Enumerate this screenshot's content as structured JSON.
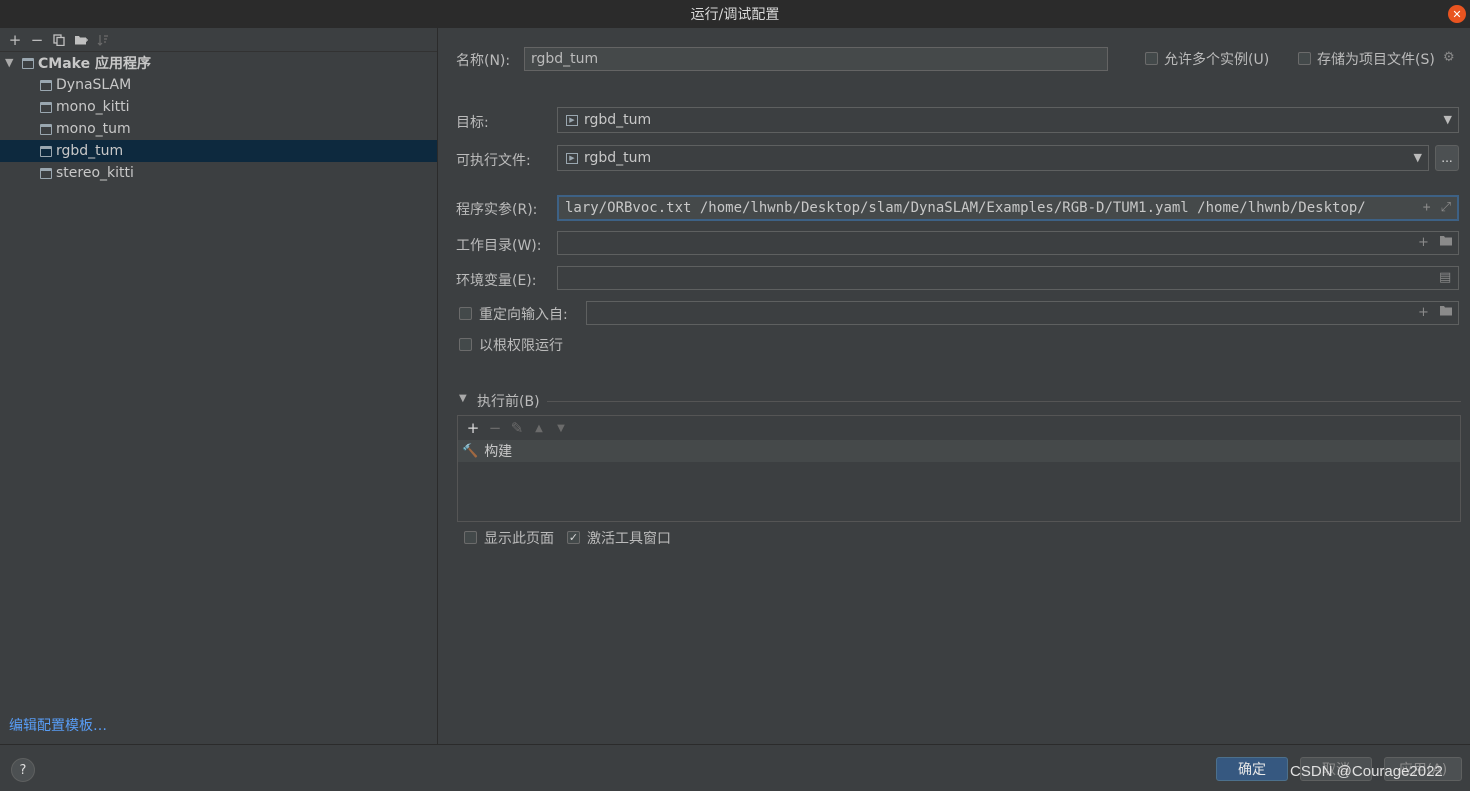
{
  "window": {
    "title": "运行/调试配置"
  },
  "left_toolbar": {
    "icons": [
      "add-icon",
      "remove-icon",
      "copy-icon",
      "folder-icon",
      "sort-icon"
    ]
  },
  "tree": {
    "group_label": "CMake 应用程序",
    "items": [
      {
        "label": "DynaSLAM",
        "selected": false
      },
      {
        "label": "mono_kitti",
        "selected": false
      },
      {
        "label": "mono_tum",
        "selected": false
      },
      {
        "label": "rgbd_tum",
        "selected": true
      },
      {
        "label": "stereo_kitti",
        "selected": false
      }
    ]
  },
  "edit_template_link": "编辑配置模板…",
  "form": {
    "name_label": "名称(N):",
    "name_value": "rgbd_tum",
    "allow_multi_label": "允许多个实例(U)",
    "store_project_label": "存储为项目文件(S)",
    "target_label": "目标:",
    "target_value": "rgbd_tum",
    "exec_label": "可执行文件:",
    "exec_value": "rgbd_tum",
    "exec_browse": "...",
    "args_label": "程序实参(R):",
    "args_value": "lary/ORBvoc.txt /home/lhwnb/Desktop/slam/DynaSLAM/Examples/RGB-D/TUM1.yaml /home/lhwnb/Desktop/",
    "workdir_label": "工作目录(W):",
    "workdir_value": "",
    "env_label": "环境变量(E):",
    "env_value": "",
    "redirect_label": "重定向输入自:",
    "redirect_value": "",
    "root_label": "以根权限运行"
  },
  "before_launch": {
    "header": "执行前(B)",
    "items": [
      {
        "label": "构建"
      }
    ],
    "show_page_label": "显示此页面",
    "activate_tool_label": "激活工具窗口",
    "activate_checked": true
  },
  "bottom": {
    "help": "?",
    "ok": "确定",
    "cancel": "取消",
    "apply": "应用(A)",
    "watermark": "CSDN @Courage2022"
  },
  "colors": {
    "background": "#3c3f41",
    "selection": "#0d293e",
    "link": "#589df6",
    "primary_button": "#365880"
  }
}
